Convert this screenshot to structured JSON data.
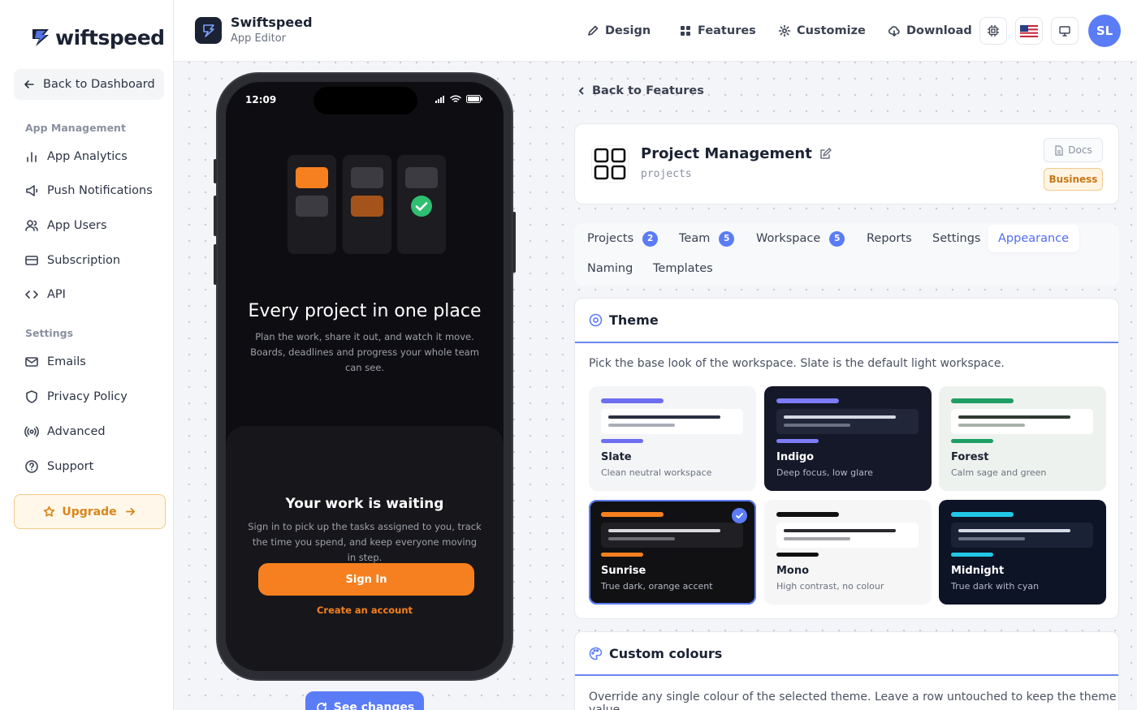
{
  "brand": {
    "logo_text": "wiftspeed"
  },
  "sidebar": {
    "back_label": "Back to Dashboard",
    "section_app": "App Management",
    "app_items": [
      {
        "label": "App Analytics",
        "icon": "bar-chart-icon"
      },
      {
        "label": "Push Notifications",
        "icon": "megaphone-icon"
      },
      {
        "label": "App Users",
        "icon": "users-icon"
      },
      {
        "label": "Subscription",
        "icon": "credit-card-icon"
      },
      {
        "label": "API",
        "icon": "code-icon"
      }
    ],
    "section_settings": "Settings",
    "settings_items": [
      {
        "label": "Emails",
        "icon": "mail-icon"
      },
      {
        "label": "Privacy Policy",
        "icon": "shield-icon"
      },
      {
        "label": "Advanced",
        "icon": "broadcast-icon"
      },
      {
        "label": "Support",
        "icon": "help-circle-icon"
      }
    ],
    "upgrade_label": "Upgrade"
  },
  "header": {
    "app_name": "Swiftspeed",
    "app_sub": "App Editor",
    "nav": [
      {
        "label": "Design",
        "icon": "pen-icon"
      },
      {
        "label": "Features",
        "icon": "grid-icon"
      },
      {
        "label": "Customize",
        "icon": "gear-icon"
      },
      {
        "label": "Download",
        "icon": "cloud-download-icon"
      }
    ],
    "avatar_initials": "SL"
  },
  "phone": {
    "time": "12:09",
    "hero_title": "Every project in one place",
    "hero_sub": "Plan the work, share it out, and watch it move. Boards, deadlines and progress your whole team can see.",
    "sheet_title": "Your work is waiting",
    "sheet_sub": "Sign in to pick up the tasks assigned to you, track the time you spend, and keep everyone moving in step.",
    "signin_label": "Sign In",
    "create_label": "Create an account",
    "accent": "#f6801f"
  },
  "see_changes_label": "See changes",
  "feature": {
    "back_label": "Back to Features",
    "title": "Project Management",
    "slug": "projects",
    "docs_label": "Docs",
    "badge": "Business"
  },
  "tabs": [
    {
      "label": "Projects",
      "count": "2"
    },
    {
      "label": "Team",
      "count": "5"
    },
    {
      "label": "Workspace",
      "count": "5"
    },
    {
      "label": "Reports"
    },
    {
      "label": "Settings"
    },
    {
      "label": "Appearance",
      "active": true
    },
    {
      "label": "Naming"
    },
    {
      "label": "Templates"
    }
  ],
  "theme_section": {
    "title": "Theme",
    "description": "Pick the base look of the workspace. Slate is the default light workspace.",
    "themes": [
      {
        "name": "Slate",
        "desc": "Clean neutral workspace",
        "bg": "#f4f5f7",
        "accent": "#6d6ef0",
        "panel": "#ffffff",
        "line1": "#2a3040",
        "line2": "#a9aeb8",
        "name_color": "#1a2233",
        "desc_color": "#6b7280"
      },
      {
        "name": "Indigo",
        "desc": "Deep focus, low glare",
        "bg": "#141828",
        "accent": "#7b7cf6",
        "panel": "#212638",
        "line1": "#d6d9e2",
        "line2": "#6b7180",
        "name_color": "#ffffff",
        "desc_color": "#b4b8c4"
      },
      {
        "name": "Forest",
        "desc": "Calm sage and green",
        "bg": "#eef2ee",
        "accent": "#1e9e63",
        "panel": "#ffffff",
        "line1": "#2f3a33",
        "line2": "#a7b3aa",
        "name_color": "#1a2233",
        "desc_color": "#6b7280"
      },
      {
        "name": "Sunrise",
        "desc": "True dark, orange accent",
        "bg": "#111114",
        "accent": "#f6801f",
        "panel": "#202024",
        "line1": "#d9d9de",
        "line2": "#6d6d74",
        "name_color": "#ffffff",
        "desc_color": "#b4b8c4",
        "selected": true
      },
      {
        "name": "Mono",
        "desc": "High contrast, no colour",
        "bg": "#f6f6f7",
        "accent": "#111111",
        "panel": "#ffffff",
        "line1": "#2a2a2e",
        "line2": "#a3a3a8",
        "name_color": "#1a2233",
        "desc_color": "#6b7280"
      },
      {
        "name": "Midnight",
        "desc": "True dark with cyan",
        "bg": "#0d1426",
        "accent": "#22c7e6",
        "panel": "#1a2236",
        "line1": "#d6dbe6",
        "line2": "#6b7486",
        "name_color": "#ffffff",
        "desc_color": "#b4b8c4"
      }
    ]
  },
  "colours_section": {
    "title": "Custom colours",
    "description": "Override any single colour of the selected theme. Leave a row untouched to keep the theme value."
  },
  "colors": {
    "primary": "#5b7cf7",
    "sidebar_text": "#2c3344",
    "upgrade": "#d9861b"
  }
}
